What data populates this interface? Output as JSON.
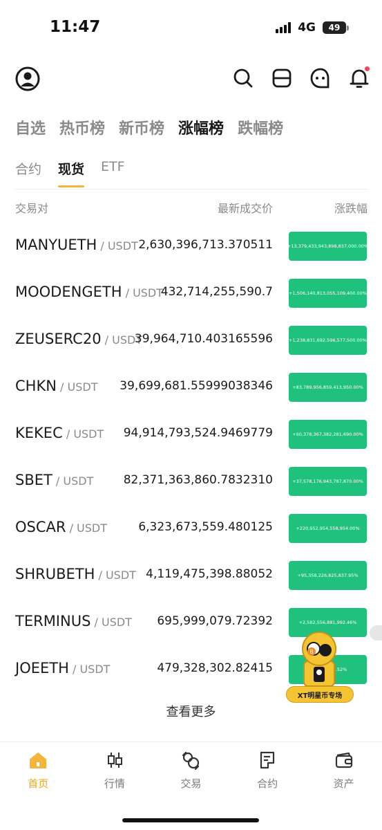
{
  "status_bar": {
    "time": "11:47",
    "network": "4G",
    "battery": "49"
  },
  "main_tabs": [
    "自选",
    "热币榜",
    "新币榜",
    "涨幅榜",
    "跌幅榜"
  ],
  "sub_tabs": [
    "合约",
    "现货",
    "ETF"
  ],
  "columns": {
    "pair": "交易对",
    "price": "最新成交价",
    "change": "涨跌幅"
  },
  "rows": [
    {
      "base": "MANYUETH",
      "quote": " / USDT",
      "price": "2,630,396,713.370511",
      "change": "+13,379,433,943,898,837,000.00%"
    },
    {
      "base": "MOODENGETH",
      "quote": " / USDT",
      "price": "432,714,255,590.7",
      "change": "+1,506,140,813,055,109,400.00%"
    },
    {
      "base": "ZEUSERC20",
      "quote": " / USDT",
      "price": "39,964,710.403165596",
      "change": "+1,238,831,692,596,577,500.00%"
    },
    {
      "base": "CHKN",
      "quote": " / USDT",
      "price": "39,699,681.55999038346",
      "change": "+83,789,956,859,413,950.00%"
    },
    {
      "base": "KEKEC",
      "quote": " / USDT",
      "price": "94,914,793,524.9469779",
      "change": "+60,378,367,382,281,690.00%"
    },
    {
      "base": "SBET",
      "quote": " / USDT",
      "price": "82,371,363,860.7832310",
      "change": "+37,578,176,943,787,870.00%"
    },
    {
      "base": "OSCAR",
      "quote": " / USDT",
      "price": "6,323,673,559.480125",
      "change": "+220,952,954,558,954.00%"
    },
    {
      "base": "SHRUBETH",
      "quote": " / USDT",
      "price": "4,119,475,398.88052",
      "change": "+95,358,226,825,837.95%"
    },
    {
      "base": "TERMINUS",
      "quote": " / USDT",
      "price": "695,999,079.72392",
      "change": "+2,582,556,881,992.46%"
    },
    {
      "base": "JOEETH",
      "quote": " / USDT",
      "price": "479,328,302.82415",
      "change": "+1,32… …1.52%"
    }
  ],
  "more_label": "查看更多",
  "promo_label": "XT明星币专场",
  "bottom_nav": [
    "首页",
    "行情",
    "交易",
    "合约",
    "资产"
  ],
  "colors": {
    "accent": "#f3b53a",
    "up": "#20c17c",
    "nav_active": "#f0a81a"
  }
}
